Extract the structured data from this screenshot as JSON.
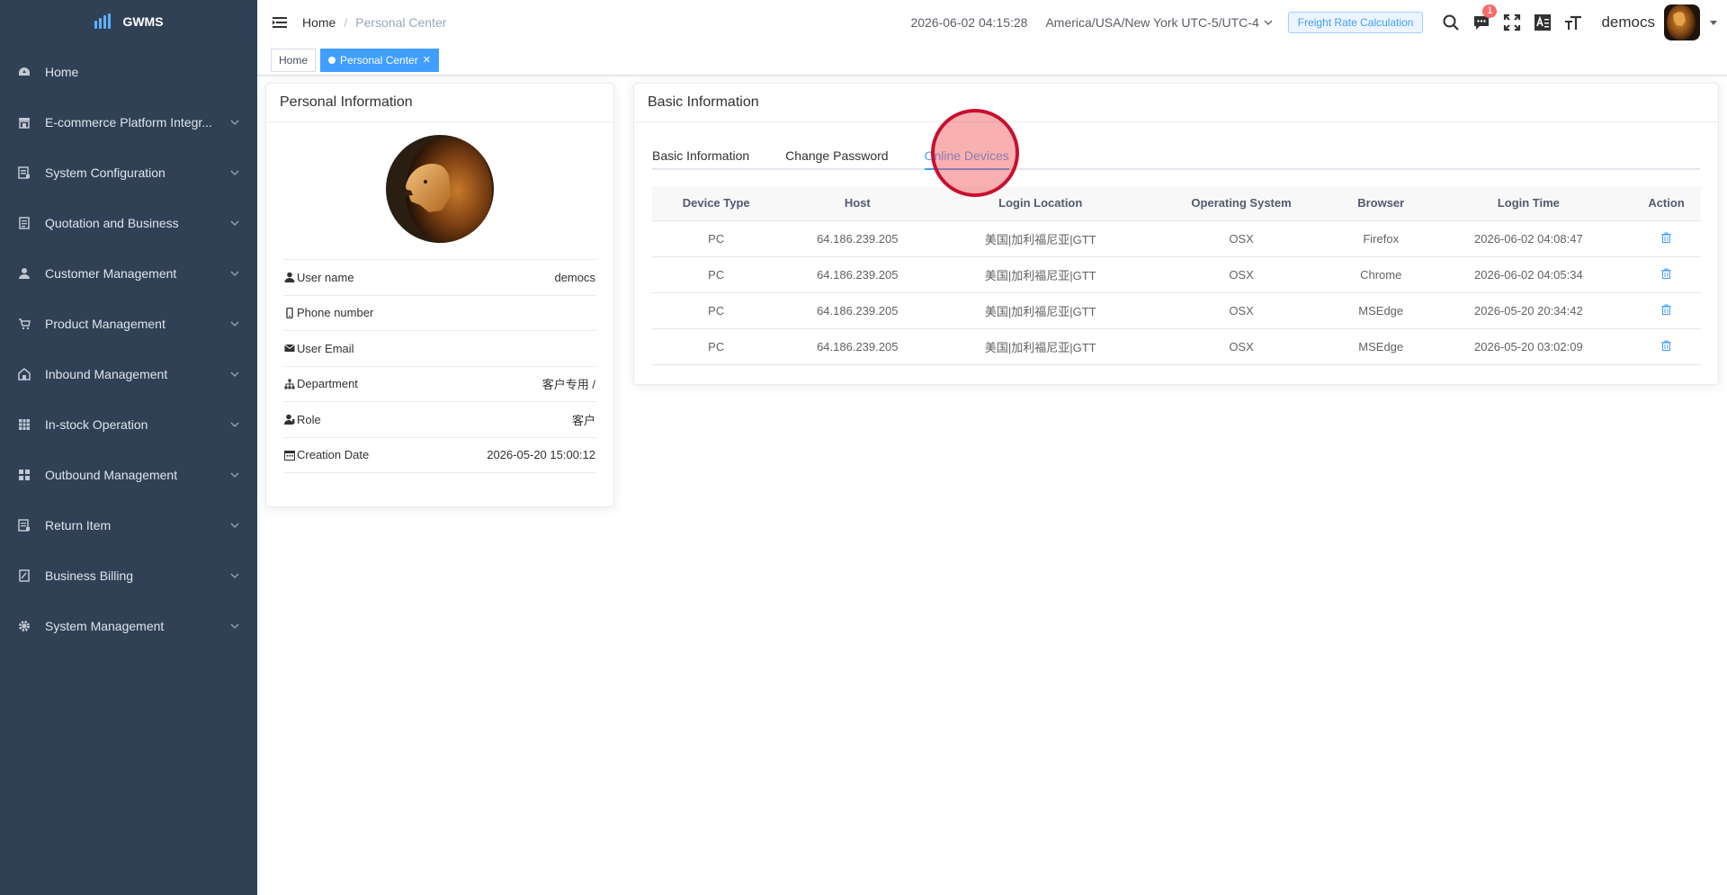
{
  "app": {
    "name": "GWMS"
  },
  "sidebar": {
    "items": [
      {
        "label": "Home",
        "icon": "dashboard-icon",
        "has_children": false
      },
      {
        "label": "E-commerce Platform Integr...",
        "icon": "store-icon",
        "has_children": true
      },
      {
        "label": "System Configuration",
        "icon": "config-icon",
        "has_children": true
      },
      {
        "label": "Quotation and Business",
        "icon": "document-icon",
        "has_children": true
      },
      {
        "label": "Customer Management",
        "icon": "user-icon",
        "has_children": true
      },
      {
        "label": "Product Management",
        "icon": "cart-icon",
        "has_children": true
      },
      {
        "label": "Inbound Management",
        "icon": "warehouse-icon",
        "has_children": true
      },
      {
        "label": "In-stock Operation",
        "icon": "table-icon",
        "has_children": true
      },
      {
        "label": "Outbound Management",
        "icon": "grid-icon",
        "has_children": true
      },
      {
        "label": "Return Item",
        "icon": "return-icon",
        "has_children": true
      },
      {
        "label": "Business Billing",
        "icon": "billing-icon",
        "has_children": true
      },
      {
        "label": "System Management",
        "icon": "gear-icon",
        "has_children": true
      }
    ]
  },
  "navbar": {
    "breadcrumb": [
      "Home",
      "Personal Center"
    ],
    "datetime": "2026-06-02 04:15:28",
    "timezone": "America/USA/New York UTC-5/UTC-4",
    "freight_button": "Freight Rate Calculation",
    "notification_count": "1",
    "username": "democs"
  },
  "tags": [
    {
      "label": "Home",
      "active": false
    },
    {
      "label": "Personal Center",
      "active": true
    }
  ],
  "profile": {
    "title": "Personal Information",
    "fields": [
      {
        "label": "User name",
        "value": "democs",
        "icon": "user-icon"
      },
      {
        "label": "Phone number",
        "value": "",
        "icon": "phone-icon"
      },
      {
        "label": "User Email",
        "value": "",
        "icon": "email-icon"
      },
      {
        "label": "Department",
        "value": "客户专用 /",
        "icon": "tree-icon"
      },
      {
        "label": "Role",
        "value": "客户",
        "icon": "role-icon"
      },
      {
        "label": "Creation Date",
        "value": "2026-05-20 15:00:12",
        "icon": "calendar-icon"
      }
    ]
  },
  "basic": {
    "title": "Basic Information",
    "tabs": [
      {
        "label": "Basic Information",
        "active": false
      },
      {
        "label": "Change Password",
        "active": false
      },
      {
        "label": "Online Devices",
        "active": true
      }
    ],
    "table": {
      "headers": [
        "Device Type",
        "Host",
        "Login Location",
        "Operating System",
        "Browser",
        "Login Time",
        "Action"
      ],
      "rows": [
        [
          "PC",
          "64.186.239.205",
          "美国|加利福尼亚|GTT",
          "OSX",
          "Firefox",
          "2026-06-02 04:08:47"
        ],
        [
          "PC",
          "64.186.239.205",
          "美国|加利福尼亚|GTT",
          "OSX",
          "Chrome",
          "2026-06-02 04:05:34"
        ],
        [
          "PC",
          "64.186.239.205",
          "美国|加利福尼亚|GTT",
          "OSX",
          "MSEdge",
          "2026-05-20 20:34:42"
        ],
        [
          "PC",
          "64.186.239.205",
          "美国|加利福尼亚|GTT",
          "OSX",
          "MSEdge",
          "2026-05-20 03:02:09"
        ]
      ]
    }
  },
  "colors": {
    "sidebar_bg": "#304156",
    "accent": "#409eff",
    "badge": "#f56c6c",
    "click_marker": "#c8102e"
  }
}
